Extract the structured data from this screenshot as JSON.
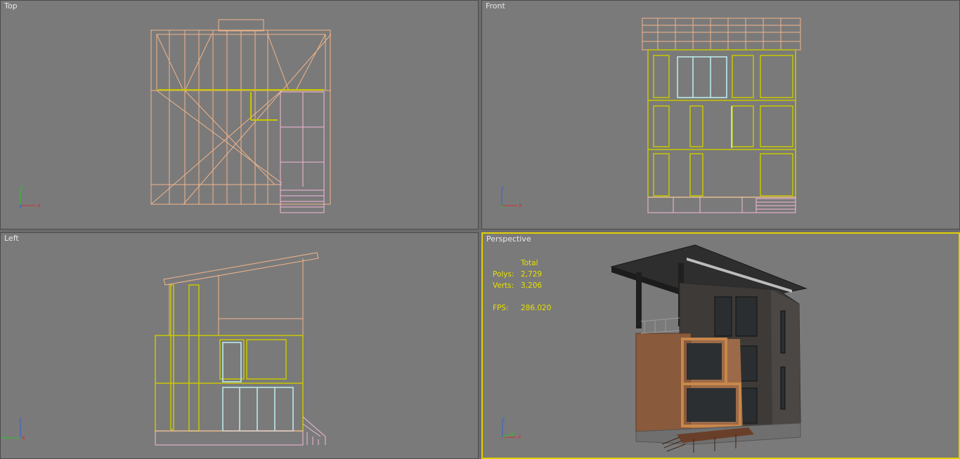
{
  "viewports": {
    "top": {
      "label": "Top"
    },
    "front": {
      "label": "Front"
    },
    "left": {
      "label": "Left"
    },
    "perspective": {
      "label": "Perspective"
    }
  },
  "stats": {
    "header": "Total",
    "polys_label": "Polys:",
    "polys_value": "2,729",
    "verts_label": "Verts:",
    "verts_value": "3,206",
    "fps_label": "FPS:",
    "fps_value": "286.020"
  },
  "axes": {
    "top": {
      "a": "y",
      "b": "x",
      "c": "z"
    },
    "front": {
      "a": "z",
      "b": "x",
      "c": "y"
    },
    "left": {
      "a": "z",
      "b": "y",
      "c": "x"
    },
    "perspective": {
      "a": "z",
      "b": "x",
      "c": "y"
    }
  },
  "colors": {
    "background": "#7a7a7a",
    "active_border": "#e0d000",
    "stats_text": "#e6e000",
    "wire_peach": "#f2b48a",
    "wire_yellow": "#c8c800",
    "wire_pink": "#f4b8d8",
    "wire_cyan": "#bff0f0"
  }
}
